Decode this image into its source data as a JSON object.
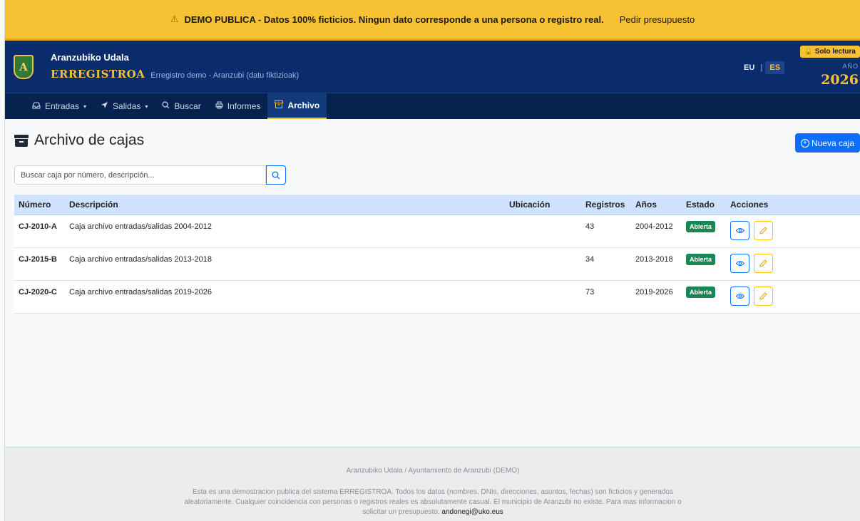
{
  "banner": {
    "warning_icon": "⚠",
    "text": "DEMO PUBLICA - Datos 100% ficticios. Ningun dato corresponde a una persona o registro real.",
    "link": "Pedir presupuesto",
    "color": "#f6c233"
  },
  "header": {
    "logo_letter": "A",
    "org_name": "Aranzubiko Udala",
    "app_title": "ERREGISTROA",
    "app_subtitle": "Erregistro demo - Aranzubi (datu fiktizioak)",
    "lang_eu": "EU",
    "lang_sep": "|",
    "lang_es": "ES",
    "readonly": "🔒 Solo lectura",
    "year_label": "AÑO",
    "year_value": "2026",
    "bg_color": "#0a2c6c"
  },
  "nav": {
    "items": [
      {
        "icon": "inbox-icon",
        "label": "Entradas",
        "caret": "▾"
      },
      {
        "icon": "send-icon",
        "label": "Salidas",
        "caret": "▾"
      },
      {
        "icon": "search-icon",
        "label": "Buscar"
      },
      {
        "icon": "printer-icon",
        "label": "Informes"
      },
      {
        "icon": "archive-icon",
        "label": "Archivo",
        "active": true
      }
    ]
  },
  "page": {
    "title": "Archivo de cajas",
    "new_button": "Nueva caja",
    "search_placeholder": "Buscar caja por número, descripción..."
  },
  "table": {
    "headers": [
      "Número",
      "Descripción",
      "Ubicación",
      "Registros",
      "Años",
      "Estado",
      "Acciones"
    ],
    "rows": [
      {
        "numero": "CJ-2010-A",
        "descripcion": "Caja archivo entradas/salidas 2004-2012",
        "ubicacion": "",
        "registros": "43",
        "anos": "2004-2012",
        "estado": "Abierta"
      },
      {
        "numero": "CJ-2015-B",
        "descripcion": "Caja archivo entradas/salidas 2013-2018",
        "ubicacion": "",
        "registros": "34",
        "anos": "2013-2018",
        "estado": "Abierta"
      },
      {
        "numero": "CJ-2020-C",
        "descripcion": "Caja archivo entradas/salidas 2019-2026",
        "ubicacion": "",
        "registros": "73",
        "anos": "2019-2026",
        "estado": "Abierta"
      }
    ]
  },
  "footer": {
    "line": "Aranzubiko Udala / Ayuntamiento de Aranzubi (DEMO)",
    "disclaimer": "Esta es una demostracion publica del sistema ERREGISTROA. Todos los datos (nombres, DNIs, direcciones, asuntos, fechas) son ficticios y generados aleatoriamente. Cualquier coincidencia con personas o registros reales es absolutamente casual. El municipio de Aranzubi no existe. Para mas informacion o solicitar un presupuesto:",
    "email": "andonegi@uko.eus"
  }
}
